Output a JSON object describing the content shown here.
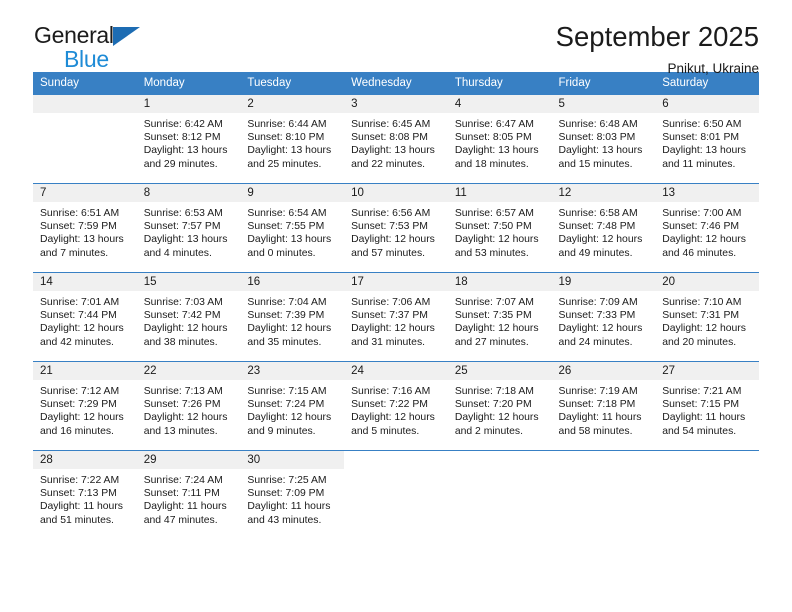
{
  "brand": {
    "name_part1": "General",
    "name_part2": "Blue",
    "triangle_color": "#1d6cb3",
    "blue_color": "#1e8bd6"
  },
  "header": {
    "title": "September 2025",
    "location": "Pnikut, Ukraine"
  },
  "theme": {
    "header_row_bg": "#3880c4",
    "daynum_bg": "#f0f0f0",
    "text_color": "#1b1b1b"
  },
  "weekdays": [
    "Sunday",
    "Monday",
    "Tuesday",
    "Wednesday",
    "Thursday",
    "Friday",
    "Saturday"
  ],
  "weeks": [
    [
      {
        "day": "",
        "blank": true,
        "sunrise": "",
        "sunset": "",
        "daylight1": "",
        "daylight2": ""
      },
      {
        "day": "1",
        "sunrise": "Sunrise: 6:42 AM",
        "sunset": "Sunset: 8:12 PM",
        "daylight1": "Daylight: 13 hours",
        "daylight2": "and 29 minutes."
      },
      {
        "day": "2",
        "sunrise": "Sunrise: 6:44 AM",
        "sunset": "Sunset: 8:10 PM",
        "daylight1": "Daylight: 13 hours",
        "daylight2": "and 25 minutes."
      },
      {
        "day": "3",
        "sunrise": "Sunrise: 6:45 AM",
        "sunset": "Sunset: 8:08 PM",
        "daylight1": "Daylight: 13 hours",
        "daylight2": "and 22 minutes."
      },
      {
        "day": "4",
        "sunrise": "Sunrise: 6:47 AM",
        "sunset": "Sunset: 8:05 PM",
        "daylight1": "Daylight: 13 hours",
        "daylight2": "and 18 minutes."
      },
      {
        "day": "5",
        "sunrise": "Sunrise: 6:48 AM",
        "sunset": "Sunset: 8:03 PM",
        "daylight1": "Daylight: 13 hours",
        "daylight2": "and 15 minutes."
      },
      {
        "day": "6",
        "sunrise": "Sunrise: 6:50 AM",
        "sunset": "Sunset: 8:01 PM",
        "daylight1": "Daylight: 13 hours",
        "daylight2": "and 11 minutes."
      }
    ],
    [
      {
        "day": "7",
        "sunrise": "Sunrise: 6:51 AM",
        "sunset": "Sunset: 7:59 PM",
        "daylight1": "Daylight: 13 hours",
        "daylight2": "and 7 minutes."
      },
      {
        "day": "8",
        "sunrise": "Sunrise: 6:53 AM",
        "sunset": "Sunset: 7:57 PM",
        "daylight1": "Daylight: 13 hours",
        "daylight2": "and 4 minutes."
      },
      {
        "day": "9",
        "sunrise": "Sunrise: 6:54 AM",
        "sunset": "Sunset: 7:55 PM",
        "daylight1": "Daylight: 13 hours",
        "daylight2": "and 0 minutes."
      },
      {
        "day": "10",
        "sunrise": "Sunrise: 6:56 AM",
        "sunset": "Sunset: 7:53 PM",
        "daylight1": "Daylight: 12 hours",
        "daylight2": "and 57 minutes."
      },
      {
        "day": "11",
        "sunrise": "Sunrise: 6:57 AM",
        "sunset": "Sunset: 7:50 PM",
        "daylight1": "Daylight: 12 hours",
        "daylight2": "and 53 minutes."
      },
      {
        "day": "12",
        "sunrise": "Sunrise: 6:58 AM",
        "sunset": "Sunset: 7:48 PM",
        "daylight1": "Daylight: 12 hours",
        "daylight2": "and 49 minutes."
      },
      {
        "day": "13",
        "sunrise": "Sunrise: 7:00 AM",
        "sunset": "Sunset: 7:46 PM",
        "daylight1": "Daylight: 12 hours",
        "daylight2": "and 46 minutes."
      }
    ],
    [
      {
        "day": "14",
        "sunrise": "Sunrise: 7:01 AM",
        "sunset": "Sunset: 7:44 PM",
        "daylight1": "Daylight: 12 hours",
        "daylight2": "and 42 minutes."
      },
      {
        "day": "15",
        "sunrise": "Sunrise: 7:03 AM",
        "sunset": "Sunset: 7:42 PM",
        "daylight1": "Daylight: 12 hours",
        "daylight2": "and 38 minutes."
      },
      {
        "day": "16",
        "sunrise": "Sunrise: 7:04 AM",
        "sunset": "Sunset: 7:39 PM",
        "daylight1": "Daylight: 12 hours",
        "daylight2": "and 35 minutes."
      },
      {
        "day": "17",
        "sunrise": "Sunrise: 7:06 AM",
        "sunset": "Sunset: 7:37 PM",
        "daylight1": "Daylight: 12 hours",
        "daylight2": "and 31 minutes."
      },
      {
        "day": "18",
        "sunrise": "Sunrise: 7:07 AM",
        "sunset": "Sunset: 7:35 PM",
        "daylight1": "Daylight: 12 hours",
        "daylight2": "and 27 minutes."
      },
      {
        "day": "19",
        "sunrise": "Sunrise: 7:09 AM",
        "sunset": "Sunset: 7:33 PM",
        "daylight1": "Daylight: 12 hours",
        "daylight2": "and 24 minutes."
      },
      {
        "day": "20",
        "sunrise": "Sunrise: 7:10 AM",
        "sunset": "Sunset: 7:31 PM",
        "daylight1": "Daylight: 12 hours",
        "daylight2": "and 20 minutes."
      }
    ],
    [
      {
        "day": "21",
        "sunrise": "Sunrise: 7:12 AM",
        "sunset": "Sunset: 7:29 PM",
        "daylight1": "Daylight: 12 hours",
        "daylight2": "and 16 minutes."
      },
      {
        "day": "22",
        "sunrise": "Sunrise: 7:13 AM",
        "sunset": "Sunset: 7:26 PM",
        "daylight1": "Daylight: 12 hours",
        "daylight2": "and 13 minutes."
      },
      {
        "day": "23",
        "sunrise": "Sunrise: 7:15 AM",
        "sunset": "Sunset: 7:24 PM",
        "daylight1": "Daylight: 12 hours",
        "daylight2": "and 9 minutes."
      },
      {
        "day": "24",
        "sunrise": "Sunrise: 7:16 AM",
        "sunset": "Sunset: 7:22 PM",
        "daylight1": "Daylight: 12 hours",
        "daylight2": "and 5 minutes."
      },
      {
        "day": "25",
        "sunrise": "Sunrise: 7:18 AM",
        "sunset": "Sunset: 7:20 PM",
        "daylight1": "Daylight: 12 hours",
        "daylight2": "and 2 minutes."
      },
      {
        "day": "26",
        "sunrise": "Sunrise: 7:19 AM",
        "sunset": "Sunset: 7:18 PM",
        "daylight1": "Daylight: 11 hours",
        "daylight2": "and 58 minutes."
      },
      {
        "day": "27",
        "sunrise": "Sunrise: 7:21 AM",
        "sunset": "Sunset: 7:15 PM",
        "daylight1": "Daylight: 11 hours",
        "daylight2": "and 54 minutes."
      }
    ],
    [
      {
        "day": "28",
        "sunrise": "Sunrise: 7:22 AM",
        "sunset": "Sunset: 7:13 PM",
        "daylight1": "Daylight: 11 hours",
        "daylight2": "and 51 minutes."
      },
      {
        "day": "29",
        "sunrise": "Sunrise: 7:24 AM",
        "sunset": "Sunset: 7:11 PM",
        "daylight1": "Daylight: 11 hours",
        "daylight2": "and 47 minutes."
      },
      {
        "day": "30",
        "sunrise": "Sunrise: 7:25 AM",
        "sunset": "Sunset: 7:09 PM",
        "daylight1": "Daylight: 11 hours",
        "daylight2": "and 43 minutes."
      },
      {
        "day": "",
        "nodate": true,
        "sunrise": "",
        "sunset": "",
        "daylight1": "",
        "daylight2": ""
      },
      {
        "day": "",
        "nodate": true,
        "sunrise": "",
        "sunset": "",
        "daylight1": "",
        "daylight2": ""
      },
      {
        "day": "",
        "nodate": true,
        "sunrise": "",
        "sunset": "",
        "daylight1": "",
        "daylight2": ""
      },
      {
        "day": "",
        "nodate": true,
        "sunrise": "",
        "sunset": "",
        "daylight1": "",
        "daylight2": ""
      }
    ]
  ]
}
